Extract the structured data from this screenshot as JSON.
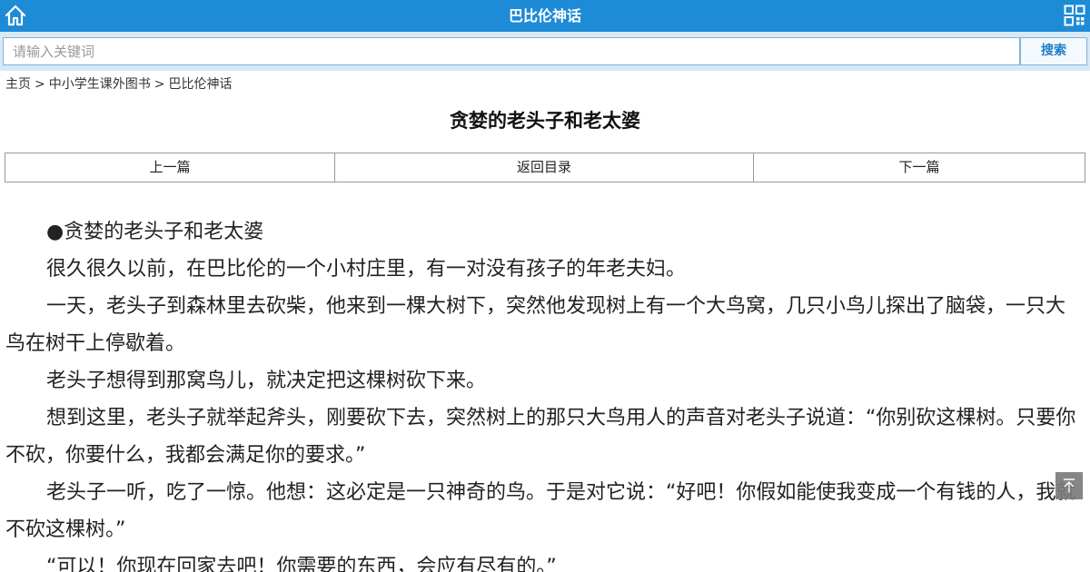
{
  "header": {
    "title": "巴比伦神话",
    "home_icon": "home-icon",
    "menu_icon": "grid-menu-icon",
    "bar_color": "#1e8bd6"
  },
  "search": {
    "placeholder": "请输入关键词",
    "value": "",
    "button_label": "搜索"
  },
  "breadcrumb": {
    "items": [
      "主页",
      "中小学生课外图书",
      "巴比伦神话"
    ],
    "separator": ">"
  },
  "article": {
    "title": "贪婪的老头子和老太婆",
    "nav": {
      "prev": "上一篇",
      "toc": "返回目录",
      "next": "下一篇"
    },
    "paragraphs": [
      "●贪婪的老头子和老太婆",
      "很久很久以前，在巴比伦的一个小村庄里，有一对没有孩子的年老夫妇。",
      "一天，老头子到森林里去砍柴，他来到一棵大树下，突然他发现树上有一个大鸟窝，几只小鸟儿探出了脑袋，一只大鸟在树干上停歇着。",
      "老头子想得到那窝鸟儿，就决定把这棵树砍下来。",
      "想到这里，老头子就举起斧头，刚要砍下去，突然树上的那只大鸟用人的声音对老头子说道：“你别砍这棵树。只要你不砍，你要什么，我都会满足你的要求。”",
      "老头子一听，吃了一惊。他想：这必定是一只神奇的鸟。于是对它说：“好吧！你假如能使我变成一个有钱的人，我就不砍这棵树。”",
      "“可以！你现在回家去吧！你需要的东西，会应有尽有的。”"
    ]
  },
  "back_to_top_icon": "back-to-top-icon"
}
